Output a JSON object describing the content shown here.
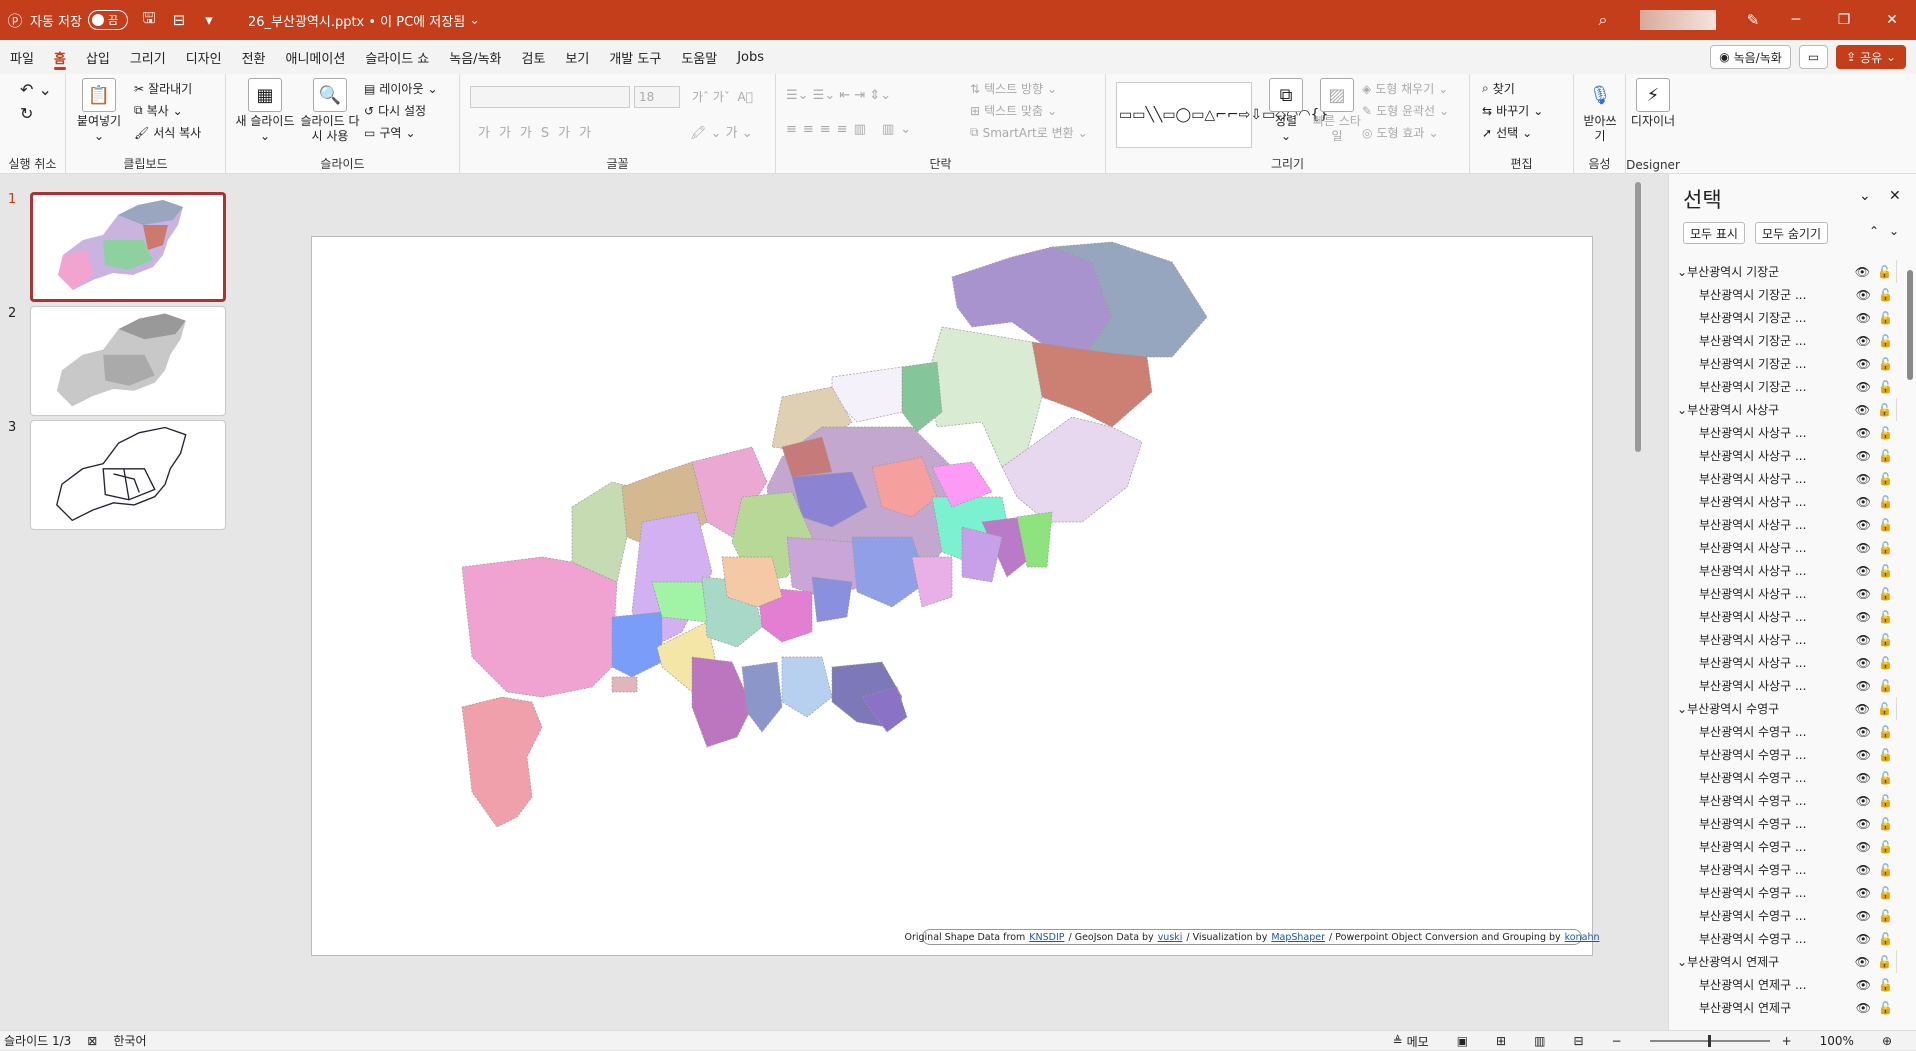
{
  "titlebar": {
    "autosave_label": "자동 저장",
    "toggle_state": "끔",
    "doc_title": "26_부산광역시.pptx • 이 PC에 저장됨",
    "color": "#c43e1c"
  },
  "menu": {
    "tabs": [
      "파일",
      "홈",
      "삽입",
      "그리기",
      "디자인",
      "전환",
      "애니메이션",
      "슬라이드 쇼",
      "녹음/녹화",
      "검토",
      "보기",
      "개발 도구",
      "도움말",
      "Jobs"
    ],
    "active_tab": "홈",
    "record_btn": "녹음/녹화",
    "share_btn": "공유"
  },
  "ribbon": {
    "undo_label": "실행 취소",
    "clipboard": {
      "paste": "붙여넣기",
      "cut": "잘라내기",
      "copy": "복사",
      "format_painter": "서식 복사",
      "label": "클립보드"
    },
    "slides": {
      "new_slide": "새 슬라이드",
      "reuse": "슬라이드 다시 사용",
      "layout": "레이아웃",
      "reset": "다시 설정",
      "section": "구역",
      "label": "슬라이드"
    },
    "font": {
      "size": "18",
      "label": "글꼴"
    },
    "paragraph": {
      "text_direction": "텍스트 방향",
      "align_text": "텍스트 맞춤",
      "smartart": "SmartArt로 변환",
      "label": "단락"
    },
    "drawing": {
      "arrange": "정렬",
      "quick_styles": "빠른 스타일",
      "fill": "도형 채우기",
      "outline": "도형 윤곽선",
      "effects": "도형 효과",
      "label": "그리기"
    },
    "editing": {
      "find": "찾기",
      "replace": "바꾸기",
      "select": "선택",
      "label": "편집"
    },
    "voice": {
      "dictate": "받아쓰기",
      "label": "음성"
    },
    "designer": {
      "btn": "디자이너",
      "label": "Designer"
    }
  },
  "thumbnails": [
    {
      "num": "1"
    },
    {
      "num": "2"
    },
    {
      "num": "3"
    }
  ],
  "slide": {
    "credit": {
      "original": "Original Shape Data from",
      "knsdip": "KNSDIP",
      "geojson": "/ GeoJson Data by",
      "vuski": "vuski",
      "vis": "/ Visualization  by",
      "mapshaper": "MapShaper",
      "ppt": "/ Powerpoint Object Conversion and Grouping  by",
      "konahn": "konahn"
    }
  },
  "selection_pane": {
    "title": "선택",
    "show_all": "모두 표시",
    "hide_all": "모두 숨기기",
    "rows": [
      {
        "label": "부산광역시 기장군",
        "group": true
      },
      {
        "label": "부산광역시 기장군 ...",
        "group": false
      },
      {
        "label": "부산광역시 기장군 ...",
        "group": false
      },
      {
        "label": "부산광역시 기장군 ...",
        "group": false
      },
      {
        "label": "부산광역시 기장군 ...",
        "group": false
      },
      {
        "label": "부산광역시 기장군 ...",
        "group": false
      },
      {
        "label": "부산광역시 사상구",
        "group": true
      },
      {
        "label": "부산광역시 사상구 ...",
        "group": false
      },
      {
        "label": "부산광역시 사상구 ...",
        "group": false
      },
      {
        "label": "부산광역시 사상구 ...",
        "group": false
      },
      {
        "label": "부산광역시 사상구 ...",
        "group": false
      },
      {
        "label": "부산광역시 사상구 ...",
        "group": false
      },
      {
        "label": "부산광역시 사상구 ...",
        "group": false
      },
      {
        "label": "부산광역시 사상구 ...",
        "group": false
      },
      {
        "label": "부산광역시 사상구 ...",
        "group": false
      },
      {
        "label": "부산광역시 사상구 ...",
        "group": false
      },
      {
        "label": "부산광역시 사상구 ...",
        "group": false
      },
      {
        "label": "부산광역시 사상구 ...",
        "group": false
      },
      {
        "label": "부산광역시 사상구 ...",
        "group": false
      },
      {
        "label": "부산광역시 수영구",
        "group": true
      },
      {
        "label": "부산광역시 수영구 ...",
        "group": false
      },
      {
        "label": "부산광역시 수영구 ...",
        "group": false
      },
      {
        "label": "부산광역시 수영구 ...",
        "group": false
      },
      {
        "label": "부산광역시 수영구 ...",
        "group": false
      },
      {
        "label": "부산광역시 수영구 ...",
        "group": false
      },
      {
        "label": "부산광역시 수영구 ...",
        "group": false
      },
      {
        "label": "부산광역시 수영구 ...",
        "group": false
      },
      {
        "label": "부산광역시 수영구 ...",
        "group": false
      },
      {
        "label": "부산광역시 수영구 ...",
        "group": false
      },
      {
        "label": "부산광역시 수영구 ...",
        "group": false
      },
      {
        "label": "부산광역시 연제구",
        "group": true
      },
      {
        "label": "부산광역시 연제구 ...",
        "group": false
      },
      {
        "label": "부산광역시 연제구",
        "group": false
      }
    ]
  },
  "status": {
    "slide_pos": "슬라이드 1/3",
    "language": "한국어",
    "notes": "메모",
    "zoom": "100%"
  }
}
